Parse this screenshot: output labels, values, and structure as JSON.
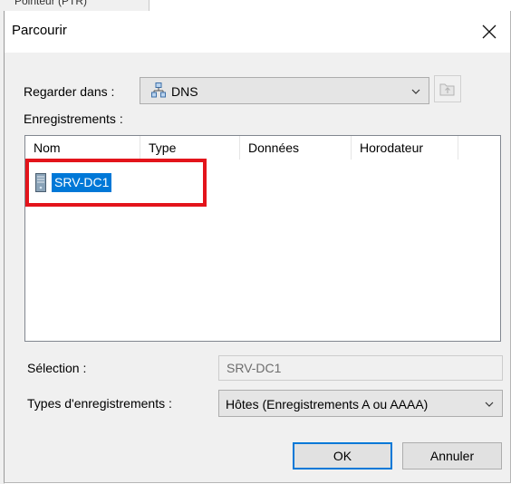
{
  "background": {
    "parent_title_fragment": "Pointeur (PTR)"
  },
  "dialog": {
    "title": "Parcourir",
    "close_glyph": "×",
    "look_in": {
      "label": "Regarder dans :",
      "value": "DNS",
      "icon": "dns-server-icon"
    },
    "up_button_icon": "folder-up-icon",
    "records_label": "Enregistrements :",
    "columns": [
      "Nom",
      "Type",
      "Données",
      "Horodateur"
    ],
    "rows": [
      {
        "name": "SRV-DC1",
        "icon": "server-icon",
        "selected": true
      }
    ],
    "selection": {
      "label": "Sélection :",
      "value": "SRV-DC1"
    },
    "record_types": {
      "label": "Types d'enregistrements :",
      "value": "Hôtes (Enregistrements A ou AAAA)"
    },
    "buttons": {
      "ok": "OK",
      "cancel": "Annuler"
    },
    "colors": {
      "accent": "#0078d7",
      "annotation": "#e3141b",
      "dialog_bg": "#f0f0f0"
    }
  }
}
